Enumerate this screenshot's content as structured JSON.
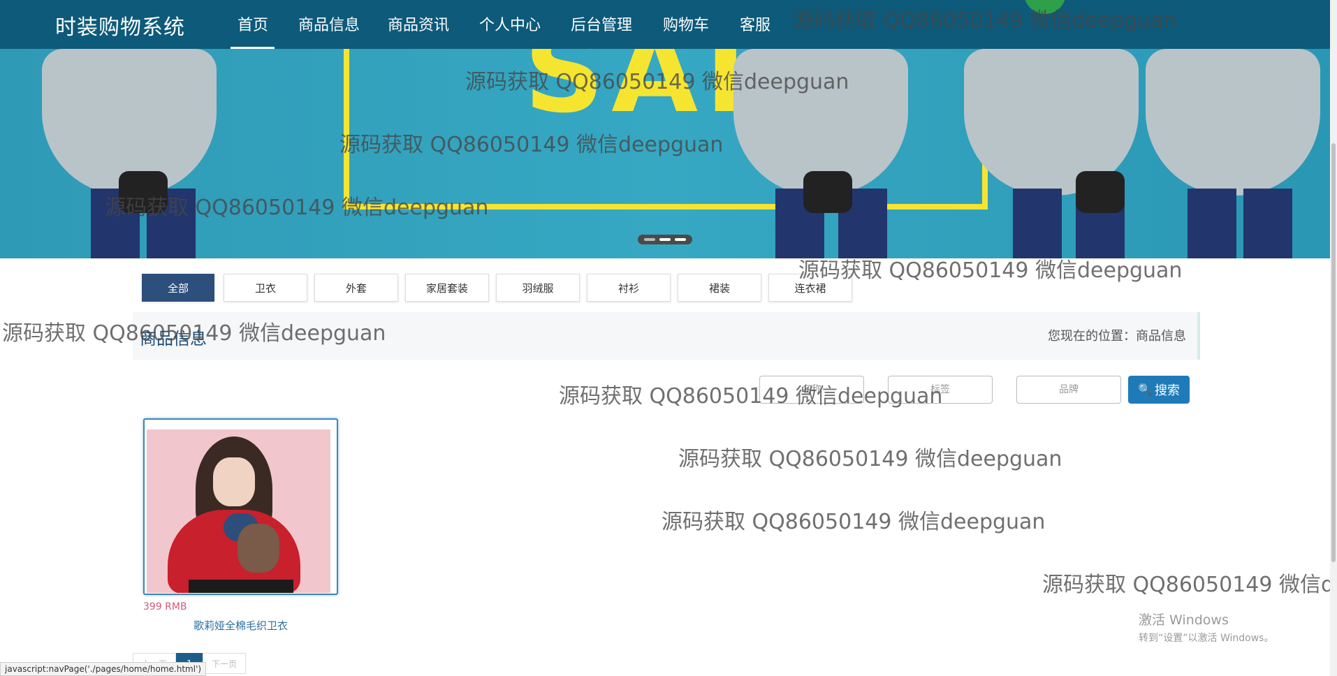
{
  "header": {
    "brand": "时装购物系统",
    "nav": [
      {
        "label": "首页"
      },
      {
        "label": "商品信息"
      },
      {
        "label": "商品资讯"
      },
      {
        "label": "个人中心"
      },
      {
        "label": "后台管理"
      },
      {
        "label": "购物车"
      },
      {
        "label": "客服"
      }
    ],
    "active_index": 0
  },
  "banner": {
    "text": "SALE",
    "active_slide": 2,
    "slides": 3
  },
  "categories": {
    "items": [
      "全部",
      "卫衣",
      "外套",
      "家居套装",
      "羽绒服",
      "衬衫",
      "裙装",
      "连衣裙"
    ],
    "active_index": 0
  },
  "section": {
    "title": "商品信息",
    "breadcrumb_label": "您现在的位置：",
    "breadcrumb_current": "商品信息"
  },
  "search": {
    "field1_placeholder": "名称",
    "field2_placeholder": "标签",
    "field3_placeholder": "品牌",
    "button_label": "搜索"
  },
  "products": [
    {
      "price": "399 RMB",
      "name": "歌莉娅全棉毛织卫衣"
    }
  ],
  "pagination": {
    "prev": "上一页",
    "current": "1",
    "next": "下一页"
  },
  "status_bar": "javascript:navPage('./pages/home/home.html')",
  "windows_activation": {
    "title": "激活 Windows",
    "subtitle": "转到“设置”以激活 Windows。"
  },
  "watermark_text": "源码获取 QQ86050149 微信deepguan",
  "colors": {
    "navbar": "#0d5a7a",
    "accent": "#1f7ab9",
    "active_tab": "#2c4f7c",
    "price": "#d05b7a"
  }
}
